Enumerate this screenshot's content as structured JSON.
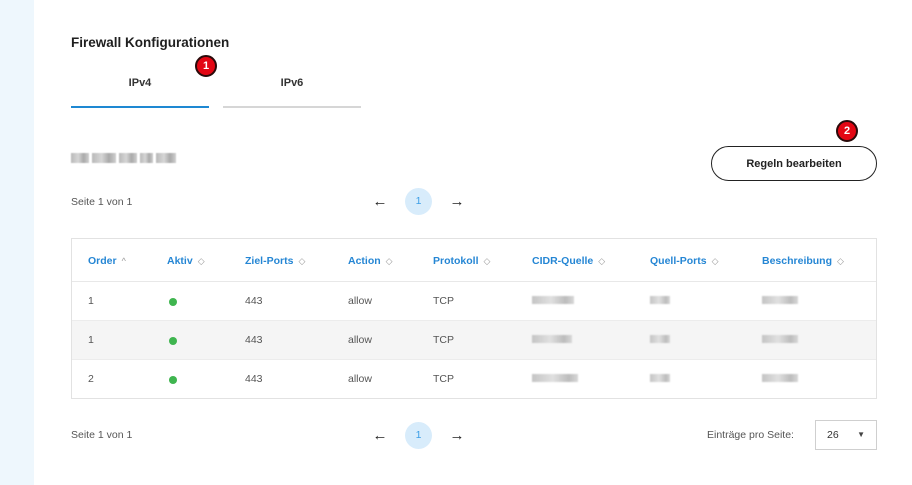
{
  "section": {
    "title": "Firewall Konfigurationen"
  },
  "tabs": [
    {
      "label": "IPv4",
      "active": true
    },
    {
      "label": "IPv6",
      "active": false
    }
  ],
  "markers": [
    "1",
    "2"
  ],
  "actions": {
    "edit_rules_label": "Regeln bearbeiten"
  },
  "pagination_top": {
    "info": "Seite 1 von 1",
    "prev_icon": "←",
    "current": "1",
    "next_icon": "→"
  },
  "table": {
    "columns": [
      {
        "label": "Order",
        "sort_icon": "^"
      },
      {
        "label": "Aktiv",
        "sort_icon": "◇"
      },
      {
        "label": "Ziel-Ports",
        "sort_icon": "◇"
      },
      {
        "label": "Action",
        "sort_icon": "◇"
      },
      {
        "label": "Protokoll",
        "sort_icon": "◇"
      },
      {
        "label": "CIDR-Quelle",
        "sort_icon": "◇"
      },
      {
        "label": "Quell-Ports",
        "sort_icon": "◇"
      },
      {
        "label": "Beschreibung",
        "sort_icon": "◇"
      }
    ],
    "rows": [
      {
        "order": "1",
        "active": true,
        "ports": "443",
        "action": "allow",
        "protocol": "TCP"
      },
      {
        "order": "1",
        "active": true,
        "ports": "443",
        "action": "allow",
        "protocol": "TCP"
      },
      {
        "order": "2",
        "active": true,
        "ports": "443",
        "action": "allow",
        "protocol": "TCP"
      }
    ],
    "active_color": "#3fb54f"
  },
  "pagination_bottom": {
    "info": "Seite 1 von 1",
    "prev_icon": "←",
    "current": "1",
    "next_icon": "→"
  },
  "per_page": {
    "label": "Einträge pro Seite:",
    "value": "26",
    "caret_icon": "▼"
  },
  "colors": {
    "accent": "#1e88d2",
    "marker": "#e30613",
    "page_bg_strip": "#eef7fd"
  }
}
